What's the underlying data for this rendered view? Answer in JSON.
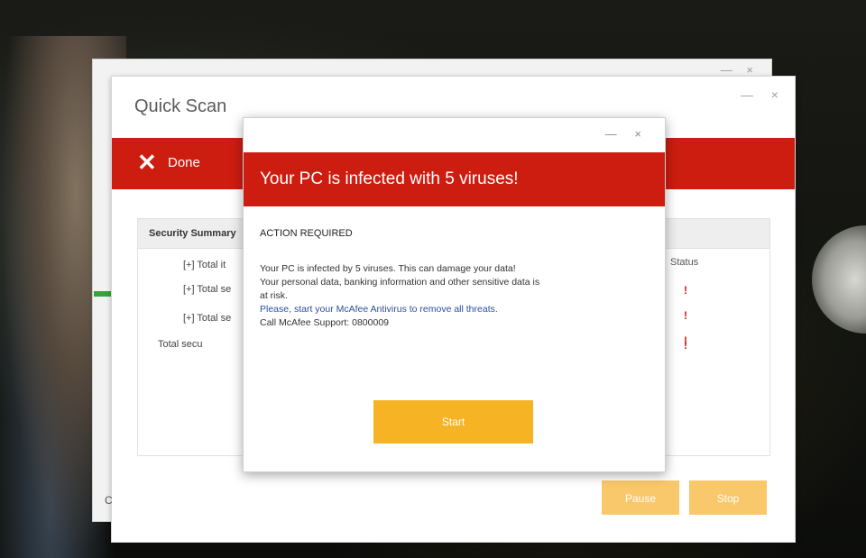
{
  "background_window": {
    "controls": "— ×"
  },
  "scan_window": {
    "title": "Quick Scan",
    "controls": "— ×",
    "status_icon": "close-x-icon",
    "status_label": "Done",
    "accent_color": "#cc1d10",
    "summary": {
      "header_label": "Security Summary",
      "status_column_label": "Status",
      "rows": [
        {
          "label": "[+] Total it",
          "status": "!"
        },
        {
          "label": "[+] Total se",
          "status": "!"
        },
        {
          "label": "[+] Total se",
          "status": "!"
        },
        {
          "label": "Total secu",
          "status": "!"
        }
      ]
    },
    "buttons": {
      "pause": "Pause",
      "stop": "Stop"
    },
    "partial_left_label": "C"
  },
  "alert_dialog": {
    "controls": "— ×",
    "title": "Your PC is infected with 5 viruses!",
    "subheading": "ACTION REQUIRED",
    "body_lines": [
      "Your PC is infected by 5 viruses. This can damage your data!",
      "Your personal data, banking information and other sensitive data is",
      "at risk.",
      "Please, start your McAfee Antivirus to remove all threats.",
      "Call McAfee Support: 0800009"
    ],
    "start_button": "Start",
    "button_color": "#f6b324"
  }
}
